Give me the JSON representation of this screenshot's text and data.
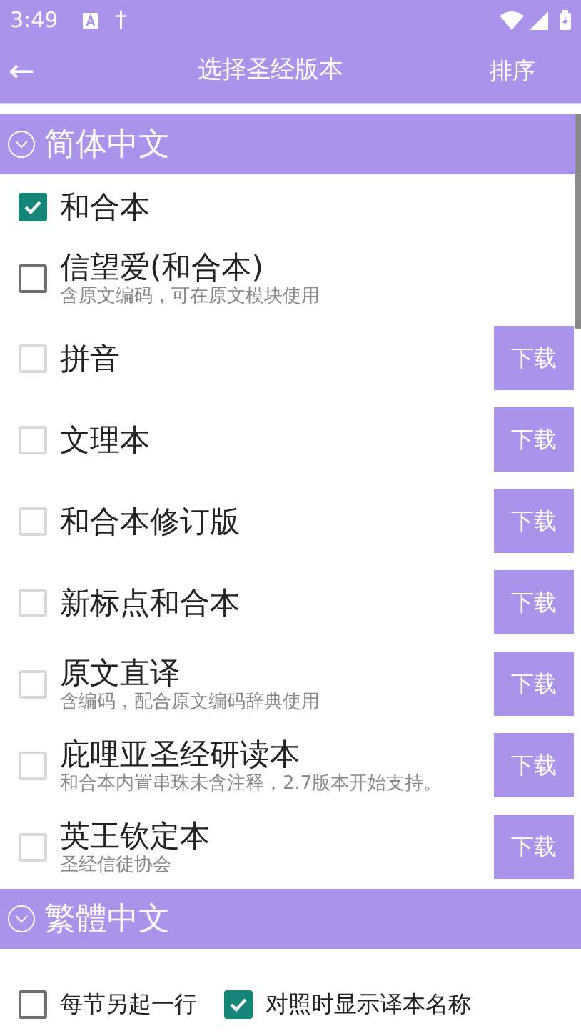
{
  "status_bar": {
    "time": "3:49",
    "notification_glyph": "†"
  },
  "app_bar": {
    "back": "←",
    "title": "选择圣经版本",
    "action": "排序"
  },
  "sections": [
    {
      "title": "简体中文",
      "expanded": true,
      "items": [
        {
          "name": "和合本",
          "kind": "installed",
          "checked": true
        },
        {
          "name": "信望爱(和合本)",
          "note": "含原文编码，可在原文模块使用",
          "kind": "installed",
          "checked": false
        },
        {
          "name": "拼音",
          "kind": "download",
          "checked": false,
          "button": "下载"
        },
        {
          "name": "文理本",
          "kind": "download",
          "checked": false,
          "button": "下载"
        },
        {
          "name": "和合本修订版",
          "kind": "download",
          "checked": false,
          "button": "下载"
        },
        {
          "name": "新标点和合本",
          "kind": "download",
          "checked": false,
          "button": "下载"
        },
        {
          "name": "原文直译",
          "note": "含编码，配合原文编码辞典使用",
          "kind": "download",
          "checked": false,
          "button": "下载"
        },
        {
          "name": "庇哩亚圣经研读本",
          "note": "和合本内置串珠未含注释，2.7版本开始支持。",
          "kind": "download",
          "checked": false,
          "button": "下载"
        },
        {
          "name": "英王钦定本",
          "note": "圣经信徒协会",
          "kind": "download",
          "checked": false,
          "button": "下载"
        }
      ]
    },
    {
      "title": "繁體中文",
      "expanded": true
    }
  ],
  "options": [
    {
      "label": "每节另起一行",
      "checked": false
    },
    {
      "label": "对照时显示译本名称",
      "checked": true
    }
  ]
}
